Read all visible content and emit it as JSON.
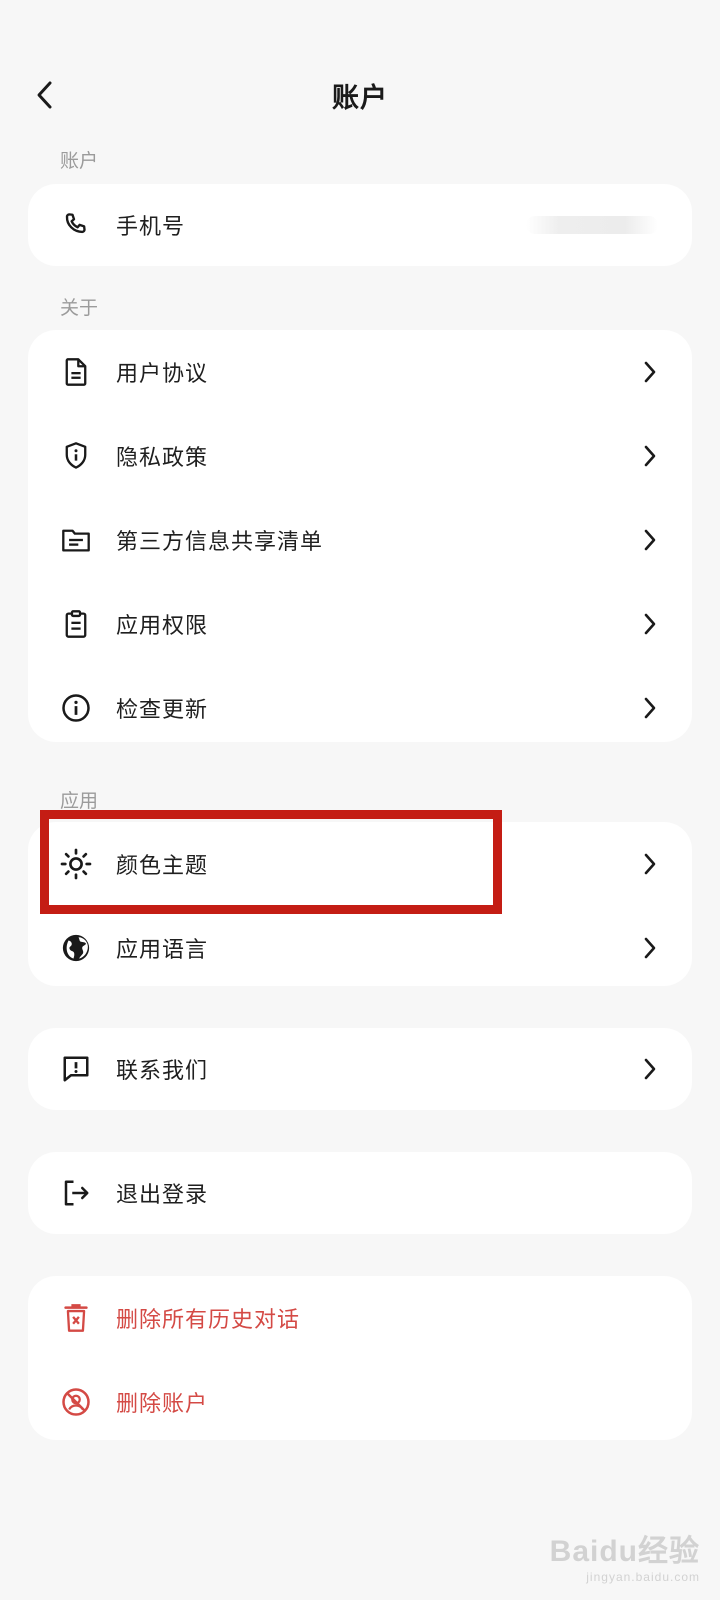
{
  "header": {
    "title": "账户"
  },
  "sections": {
    "account": "账户",
    "about": "关于",
    "app": "应用"
  },
  "account_card": {
    "phone_label": "手机号"
  },
  "about_card": {
    "items": [
      {
        "label": "用户协议",
        "icon": "document-icon"
      },
      {
        "label": "隐私政策",
        "icon": "shield-info-icon"
      },
      {
        "label": "第三方信息共享清单",
        "icon": "folder-list-icon"
      },
      {
        "label": "应用权限",
        "icon": "clipboard-icon"
      },
      {
        "label": "检查更新",
        "icon": "info-icon"
      }
    ]
  },
  "app_card": {
    "items": [
      {
        "label": "颜色主题",
        "icon": "sun-icon"
      },
      {
        "label": "应用语言",
        "icon": "globe-icon"
      }
    ]
  },
  "contact_card": {
    "label": "联系我们",
    "icon": "feedback-icon"
  },
  "logout_card": {
    "label": "退出登录",
    "icon": "logout-icon"
  },
  "danger_card": {
    "items": [
      {
        "label": "删除所有历史对话",
        "icon": "trash-icon"
      },
      {
        "label": "删除账户",
        "icon": "delete-account-icon"
      }
    ]
  },
  "colors": {
    "danger": "#d44a45",
    "highlight": "#c41d14"
  },
  "watermark": {
    "main": "Baidu经验",
    "sub": "jingyan.baidu.com"
  }
}
